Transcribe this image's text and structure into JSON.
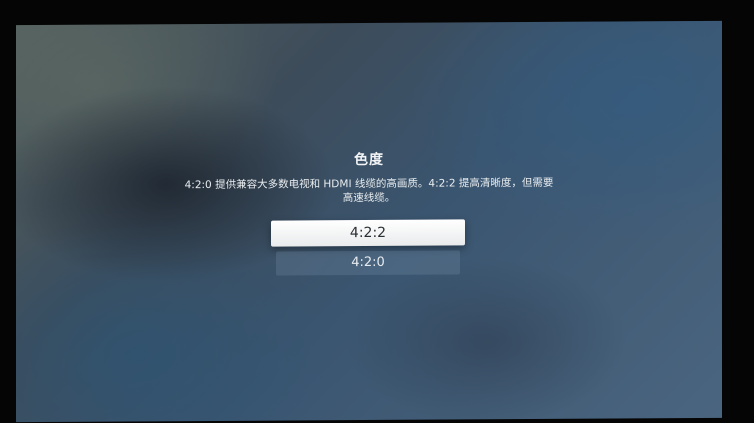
{
  "dialog": {
    "title": "色度",
    "description_line1": "4:2:0 提供兼容大多数电视和 HDMI 线缆的高画质。4:2:2 提高清晰度，但需要",
    "description_line2": "高速线缆。"
  },
  "options": [
    {
      "label": "4:2:2",
      "state": "focused"
    },
    {
      "label": "4:2:0",
      "state": "normal"
    }
  ],
  "colors": {
    "background_tone": "#3d4c5a",
    "focused_option_bg": "#ffffff",
    "focused_option_text": "#2a2f33",
    "text": "#f2f4f6"
  }
}
